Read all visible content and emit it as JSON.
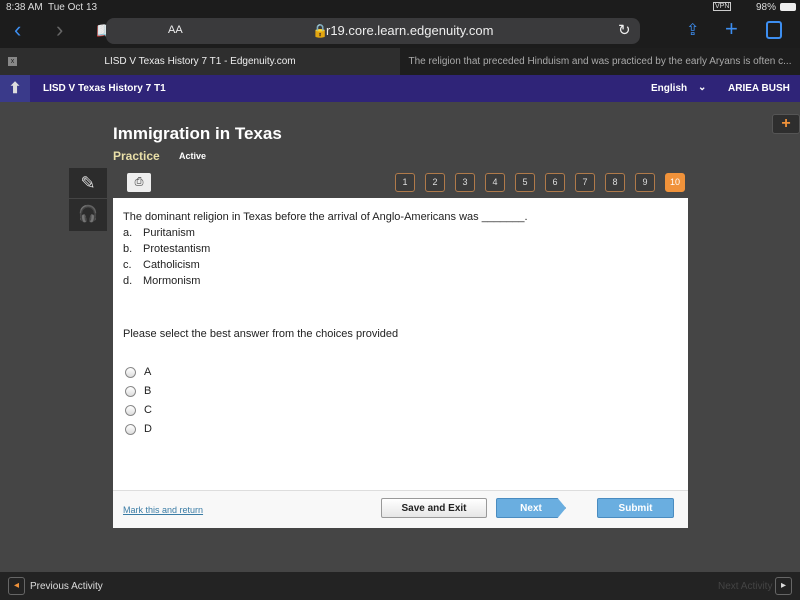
{
  "status": {
    "time": "8:38 AM",
    "date": "Tue Oct 13",
    "battery": "98%",
    "vpn": "VPN"
  },
  "browser": {
    "text_size": "AA",
    "url": "r19.core.learn.edgenuity.com"
  },
  "tabs": [
    {
      "label": "LISD V Texas History 7 T1 - Edgenuity.com",
      "close": "x"
    },
    {
      "label": "The religion that preceded Hinduism and was practiced by the early Aryans is often c..."
    }
  ],
  "nav": {
    "course": "LISD V Texas History 7 T1",
    "language": "English",
    "user": "ARIEA BUSH"
  },
  "header": {
    "title": "Immigration in Texas",
    "mode": "Practice",
    "state": "Active"
  },
  "question_numbers": [
    "1",
    "2",
    "3",
    "4",
    "5",
    "6",
    "7",
    "8",
    "9",
    "10"
  ],
  "current_question": "10",
  "question": {
    "prompt": "The dominant religion in Texas before the arrival of Anglo-Americans was _______.",
    "choices": [
      {
        "letter": "a.",
        "text": "Puritanism"
      },
      {
        "letter": "b.",
        "text": "Protestantism"
      },
      {
        "letter": "c.",
        "text": "Catholicism"
      },
      {
        "letter": "d.",
        "text": "Mormonism"
      }
    ],
    "instruction": "Please select the best answer from the choices provided",
    "options": [
      "A",
      "B",
      "C",
      "D"
    ]
  },
  "actions": {
    "mark": "Mark this and return",
    "save": "Save and Exit",
    "next": "Next",
    "submit": "Submit"
  },
  "footer": {
    "prev": "Previous Activity",
    "next": "Next Activity"
  },
  "colors": {
    "nav": "#2f2478",
    "accent": "#f0923a",
    "button_blue": "#6aaee0"
  }
}
